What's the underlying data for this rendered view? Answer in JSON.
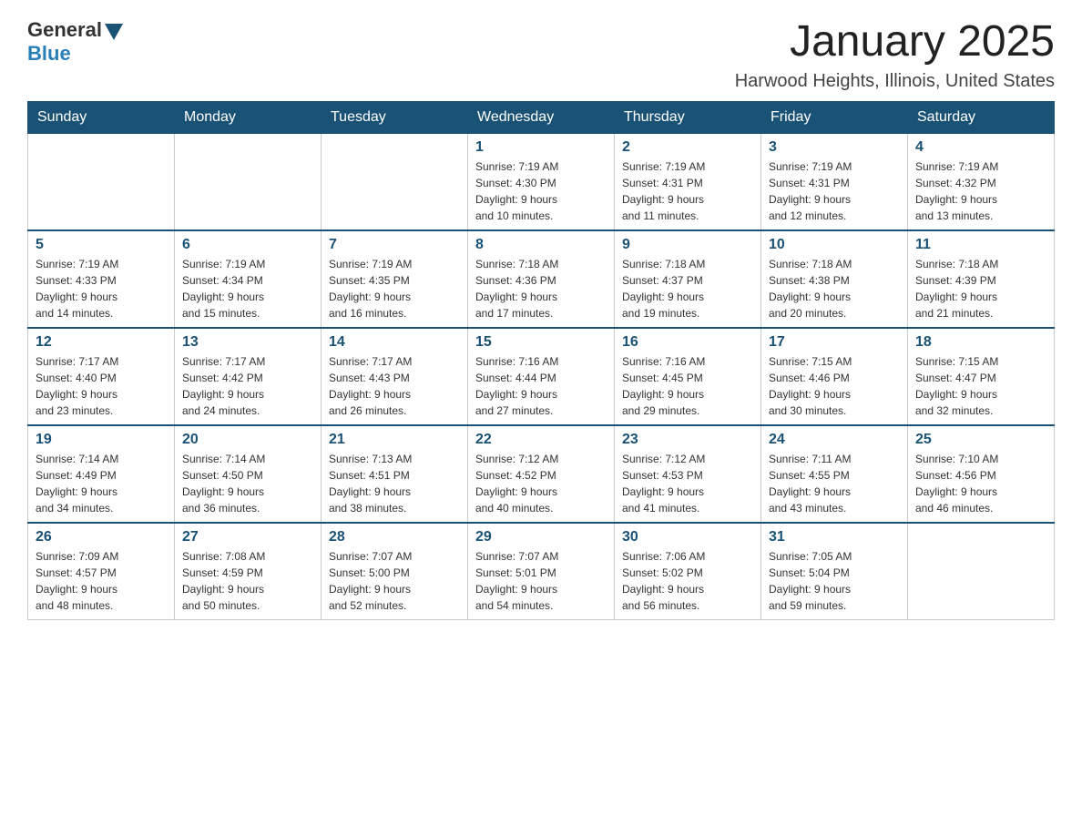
{
  "logo": {
    "general": "General",
    "blue": "Blue"
  },
  "header": {
    "month_year": "January 2025",
    "location": "Harwood Heights, Illinois, United States"
  },
  "days_of_week": [
    "Sunday",
    "Monday",
    "Tuesday",
    "Wednesday",
    "Thursday",
    "Friday",
    "Saturday"
  ],
  "weeks": [
    [
      {
        "day": "",
        "info": ""
      },
      {
        "day": "",
        "info": ""
      },
      {
        "day": "",
        "info": ""
      },
      {
        "day": "1",
        "info": "Sunrise: 7:19 AM\nSunset: 4:30 PM\nDaylight: 9 hours\nand 10 minutes."
      },
      {
        "day": "2",
        "info": "Sunrise: 7:19 AM\nSunset: 4:31 PM\nDaylight: 9 hours\nand 11 minutes."
      },
      {
        "day": "3",
        "info": "Sunrise: 7:19 AM\nSunset: 4:31 PM\nDaylight: 9 hours\nand 12 minutes."
      },
      {
        "day": "4",
        "info": "Sunrise: 7:19 AM\nSunset: 4:32 PM\nDaylight: 9 hours\nand 13 minutes."
      }
    ],
    [
      {
        "day": "5",
        "info": "Sunrise: 7:19 AM\nSunset: 4:33 PM\nDaylight: 9 hours\nand 14 minutes."
      },
      {
        "day": "6",
        "info": "Sunrise: 7:19 AM\nSunset: 4:34 PM\nDaylight: 9 hours\nand 15 minutes."
      },
      {
        "day": "7",
        "info": "Sunrise: 7:19 AM\nSunset: 4:35 PM\nDaylight: 9 hours\nand 16 minutes."
      },
      {
        "day": "8",
        "info": "Sunrise: 7:18 AM\nSunset: 4:36 PM\nDaylight: 9 hours\nand 17 minutes."
      },
      {
        "day": "9",
        "info": "Sunrise: 7:18 AM\nSunset: 4:37 PM\nDaylight: 9 hours\nand 19 minutes."
      },
      {
        "day": "10",
        "info": "Sunrise: 7:18 AM\nSunset: 4:38 PM\nDaylight: 9 hours\nand 20 minutes."
      },
      {
        "day": "11",
        "info": "Sunrise: 7:18 AM\nSunset: 4:39 PM\nDaylight: 9 hours\nand 21 minutes."
      }
    ],
    [
      {
        "day": "12",
        "info": "Sunrise: 7:17 AM\nSunset: 4:40 PM\nDaylight: 9 hours\nand 23 minutes."
      },
      {
        "day": "13",
        "info": "Sunrise: 7:17 AM\nSunset: 4:42 PM\nDaylight: 9 hours\nand 24 minutes."
      },
      {
        "day": "14",
        "info": "Sunrise: 7:17 AM\nSunset: 4:43 PM\nDaylight: 9 hours\nand 26 minutes."
      },
      {
        "day": "15",
        "info": "Sunrise: 7:16 AM\nSunset: 4:44 PM\nDaylight: 9 hours\nand 27 minutes."
      },
      {
        "day": "16",
        "info": "Sunrise: 7:16 AM\nSunset: 4:45 PM\nDaylight: 9 hours\nand 29 minutes."
      },
      {
        "day": "17",
        "info": "Sunrise: 7:15 AM\nSunset: 4:46 PM\nDaylight: 9 hours\nand 30 minutes."
      },
      {
        "day": "18",
        "info": "Sunrise: 7:15 AM\nSunset: 4:47 PM\nDaylight: 9 hours\nand 32 minutes."
      }
    ],
    [
      {
        "day": "19",
        "info": "Sunrise: 7:14 AM\nSunset: 4:49 PM\nDaylight: 9 hours\nand 34 minutes."
      },
      {
        "day": "20",
        "info": "Sunrise: 7:14 AM\nSunset: 4:50 PM\nDaylight: 9 hours\nand 36 minutes."
      },
      {
        "day": "21",
        "info": "Sunrise: 7:13 AM\nSunset: 4:51 PM\nDaylight: 9 hours\nand 38 minutes."
      },
      {
        "day": "22",
        "info": "Sunrise: 7:12 AM\nSunset: 4:52 PM\nDaylight: 9 hours\nand 40 minutes."
      },
      {
        "day": "23",
        "info": "Sunrise: 7:12 AM\nSunset: 4:53 PM\nDaylight: 9 hours\nand 41 minutes."
      },
      {
        "day": "24",
        "info": "Sunrise: 7:11 AM\nSunset: 4:55 PM\nDaylight: 9 hours\nand 43 minutes."
      },
      {
        "day": "25",
        "info": "Sunrise: 7:10 AM\nSunset: 4:56 PM\nDaylight: 9 hours\nand 46 minutes."
      }
    ],
    [
      {
        "day": "26",
        "info": "Sunrise: 7:09 AM\nSunset: 4:57 PM\nDaylight: 9 hours\nand 48 minutes."
      },
      {
        "day": "27",
        "info": "Sunrise: 7:08 AM\nSunset: 4:59 PM\nDaylight: 9 hours\nand 50 minutes."
      },
      {
        "day": "28",
        "info": "Sunrise: 7:07 AM\nSunset: 5:00 PM\nDaylight: 9 hours\nand 52 minutes."
      },
      {
        "day": "29",
        "info": "Sunrise: 7:07 AM\nSunset: 5:01 PM\nDaylight: 9 hours\nand 54 minutes."
      },
      {
        "day": "30",
        "info": "Sunrise: 7:06 AM\nSunset: 5:02 PM\nDaylight: 9 hours\nand 56 minutes."
      },
      {
        "day": "31",
        "info": "Sunrise: 7:05 AM\nSunset: 5:04 PM\nDaylight: 9 hours\nand 59 minutes."
      },
      {
        "day": "",
        "info": ""
      }
    ]
  ]
}
